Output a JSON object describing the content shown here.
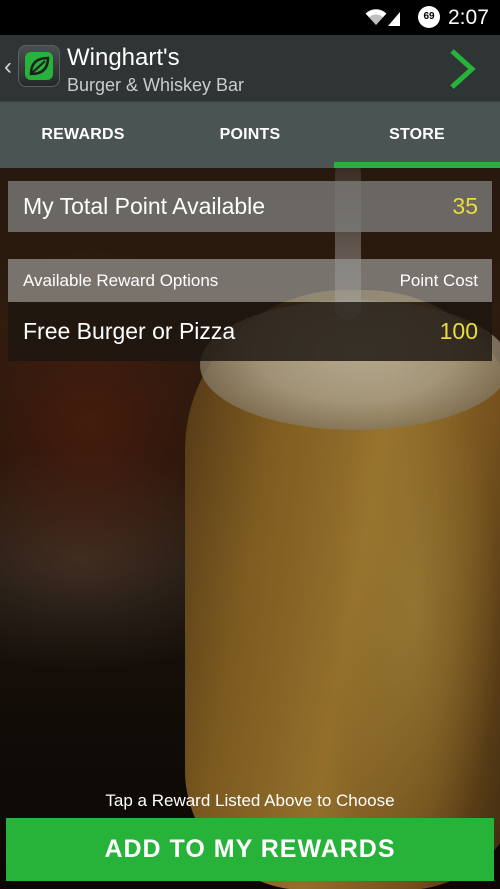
{
  "status_bar": {
    "battery_level": "69",
    "time": "2:07",
    "icons": [
      "wifi-icon",
      "signal-icon",
      "battery-icon"
    ]
  },
  "header": {
    "title": "Winghart's",
    "subtitle": "Burger & Whiskey Bar",
    "logo_icon": "leaf-logo-icon",
    "back_icon": "chevron-left-icon",
    "next_icon": "chevron-right-icon"
  },
  "tabs": [
    {
      "label": "REWARDS",
      "selected": false
    },
    {
      "label": "POINTS",
      "selected": false
    },
    {
      "label": "STORE",
      "selected": true
    }
  ],
  "points": {
    "label": "My Total Point Available",
    "value": "35"
  },
  "reward_options": {
    "header_left": "Available Reward Options",
    "header_right": "Point Cost",
    "items": [
      {
        "name": "Free Burger or Pizza",
        "cost": "100"
      }
    ]
  },
  "footer": {
    "hint": "Tap a Reward Listed Above to Choose",
    "cta_label": "ADD TO MY REWARDS"
  },
  "colors": {
    "accent_green": "#27b23a",
    "value_yellow": "#e9dc3c",
    "action_bar": "#2f3534",
    "tab_bar": "#4a5453"
  }
}
